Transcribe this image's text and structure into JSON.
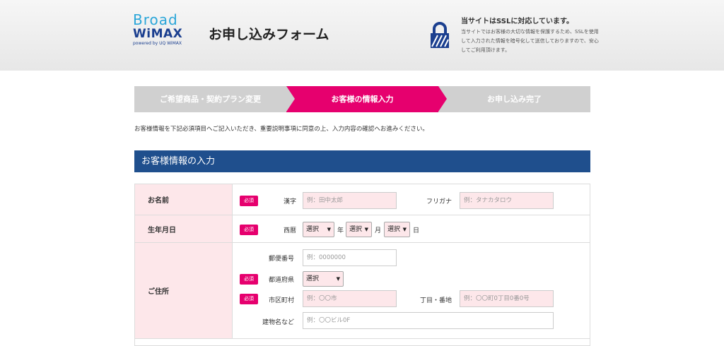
{
  "header": {
    "logo_line1": "Broad",
    "logo_line2": "WiMAX",
    "logo_powered": "powered by UQ WiMAX",
    "title": "お申し込みフォーム",
    "ssl_title": "当サイトはSSLに対応しています。",
    "ssl_text": "当サイトではお客様の大切な情報を保護するため、SSLを使用して入力された情報を暗号化して送信しておりますので、安心してご利用頂けます。",
    "ssl_icon": "lock-icon"
  },
  "steps": [
    {
      "label": "ご希望商品・契約プラン変更",
      "active": false
    },
    {
      "label": "お客様の情報入力",
      "active": true
    },
    {
      "label": "お申し込み完了",
      "active": false
    }
  ],
  "intro_text": "お客様情報を下記必須項目へご記入いただき、重要説明事項に同意の上、入力内容の確認へお進みください。",
  "section_title": "お客様情報の入力",
  "required_label": "必須",
  "form": {
    "name": {
      "label": "お名前",
      "kanji_label": "漢字",
      "kanji_placeholder": "例：田中太郎",
      "furigana_label": "フリガナ",
      "furigana_placeholder": "例：タナカタロウ"
    },
    "birthdate": {
      "label": "生年月日",
      "era_label": "西暦",
      "select_value": "選択",
      "year_unit": "年",
      "month_unit": "月",
      "day_unit": "日"
    },
    "address": {
      "label": "ご住所",
      "postal_label": "郵便番号",
      "postal_placeholder": "例：0000000",
      "prefecture_label": "都道府県",
      "prefecture_value": "選択",
      "city_label": "市区町村",
      "city_placeholder": "例：〇〇市",
      "street_label": "丁目・番地",
      "street_placeholder": "例：〇〇町0丁目0番0号",
      "building_label": "建物名など",
      "building_placeholder": "例：〇〇ビル0F"
    }
  },
  "colors": {
    "accent": "#e6006e",
    "section_header": "#1f4f8d",
    "step_inactive": "#d0d0d0",
    "field_bg": "#fde7ea"
  }
}
